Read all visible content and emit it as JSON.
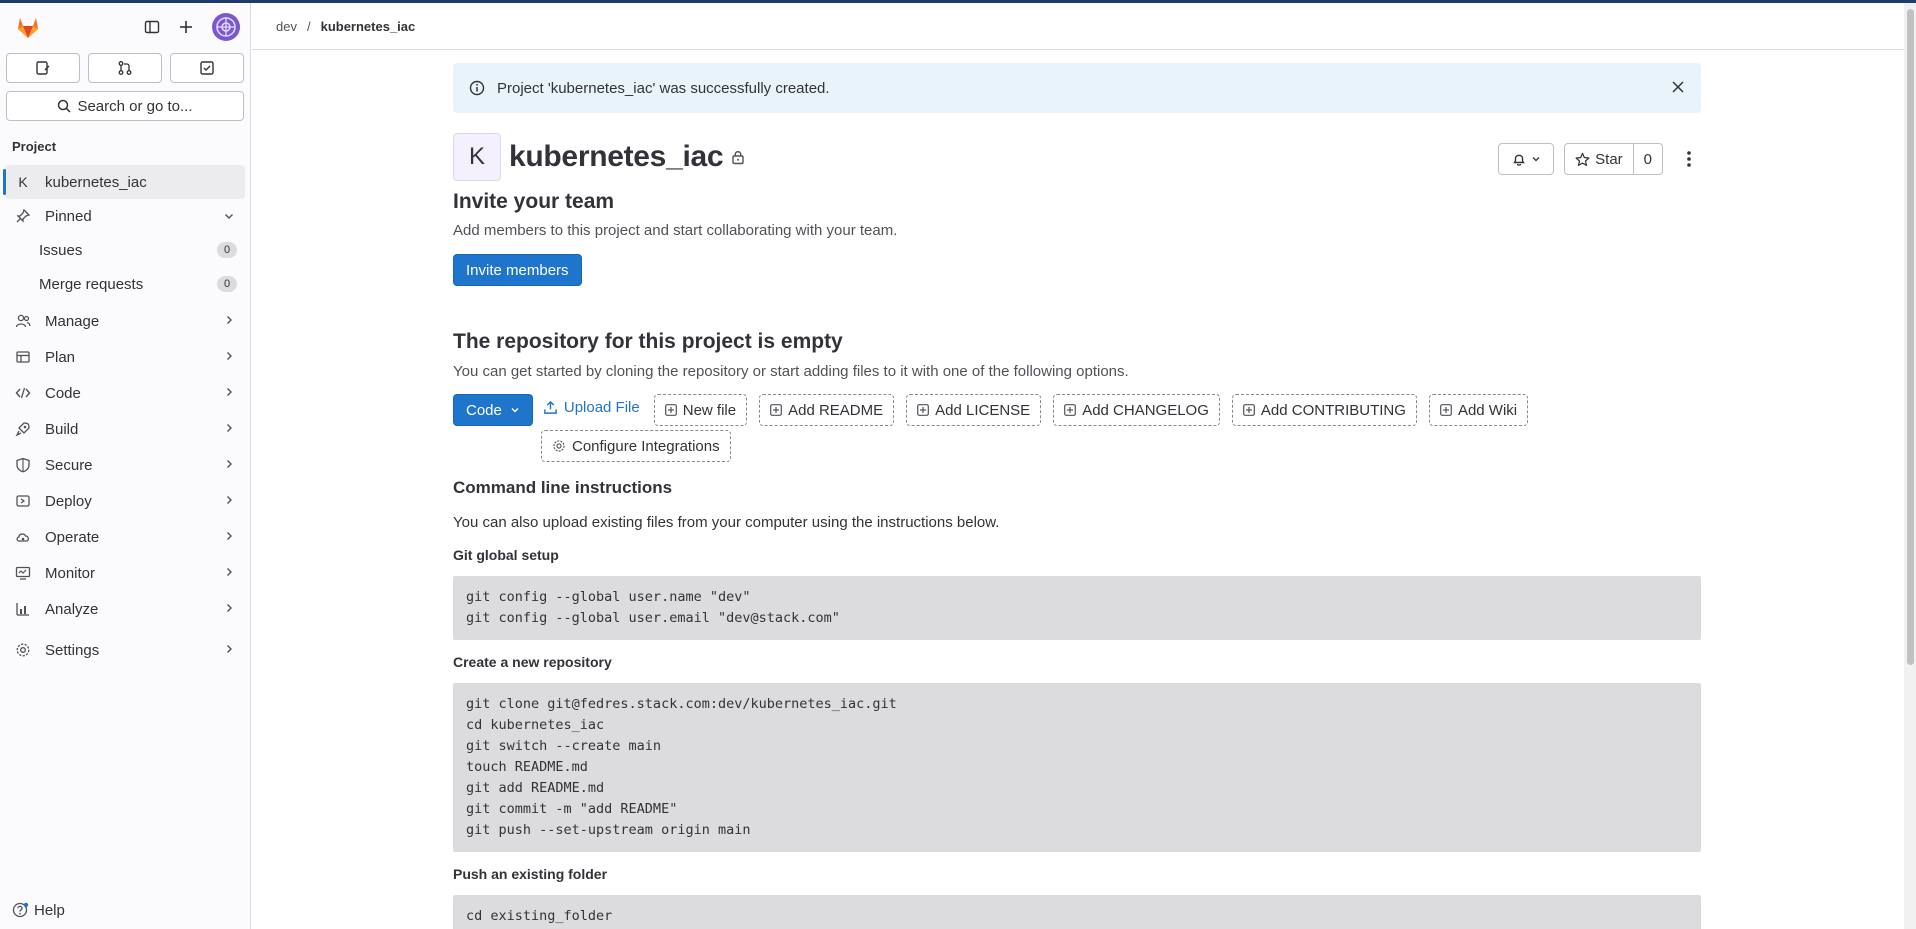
{
  "breadcrumb": {
    "parent": "dev",
    "current": "kubernetes_iac"
  },
  "sidebar": {
    "search_label": "Search or go to...",
    "section_title": "Project",
    "project_item": {
      "badge": "K",
      "label": "kubernetes_iac"
    },
    "pinned_label": "Pinned",
    "pinned_items": [
      {
        "label": "Issues",
        "count": "0"
      },
      {
        "label": "Merge requests",
        "count": "0"
      }
    ],
    "nav_items": [
      {
        "label": "Manage",
        "icon": "users-icon"
      },
      {
        "label": "Plan",
        "icon": "plan-icon"
      },
      {
        "label": "Code",
        "icon": "code-icon"
      },
      {
        "label": "Build",
        "icon": "rocket-icon"
      },
      {
        "label": "Secure",
        "icon": "shield-icon"
      },
      {
        "label": "Deploy",
        "icon": "deployments-icon"
      },
      {
        "label": "Operate",
        "icon": "cloud-gear-icon"
      },
      {
        "label": "Monitor",
        "icon": "monitor-icon"
      },
      {
        "label": "Analyze",
        "icon": "chart-icon"
      },
      {
        "label": "Settings",
        "icon": "gear-icon"
      }
    ],
    "help_label": "Help"
  },
  "alert": {
    "message": "Project 'kubernetes_iac' was successfully created."
  },
  "project": {
    "avatar_letter": "K",
    "name": "kubernetes_iac",
    "star_label": "Star",
    "star_count": "0"
  },
  "invite": {
    "title": "Invite your team",
    "description": "Add members to this project and start collaborating with your team.",
    "button": "Invite members"
  },
  "empty_repo": {
    "title": "The repository for this project is empty",
    "description": "You can get started by cloning the repository or start adding files to it with one of the following options.",
    "code_button": "Code",
    "upload_button": "Upload File",
    "actions": [
      "New file",
      "Add README",
      "Add LICENSE",
      "Add CHANGELOG",
      "Add CONTRIBUTING",
      "Add Wiki"
    ],
    "configure_button": "Configure Integrations"
  },
  "cli": {
    "title": "Command line instructions",
    "description": "You can also upload existing files from your computer using the instructions below.",
    "sections": [
      {
        "title": "Git global setup",
        "code": "git config --global user.name \"dev\"\ngit config --global user.email \"dev@stack.com\""
      },
      {
        "title": "Create a new repository",
        "code": "git clone git@fedres.stack.com:dev/kubernetes_iac.git\ncd kubernetes_iac\ngit switch --create main\ntouch README.md\ngit add README.md\ngit commit -m \"add README\"\ngit push --set-upstream origin main"
      },
      {
        "title": "Push an existing folder",
        "code": "cd existing_folder\ngit init --initial-branch=main"
      }
    ]
  },
  "colors": {
    "brand": "#fc6d26",
    "primary": "#1f75cb",
    "alert_bg": "#e9f3fc",
    "code_bg": "#dcdcde"
  }
}
